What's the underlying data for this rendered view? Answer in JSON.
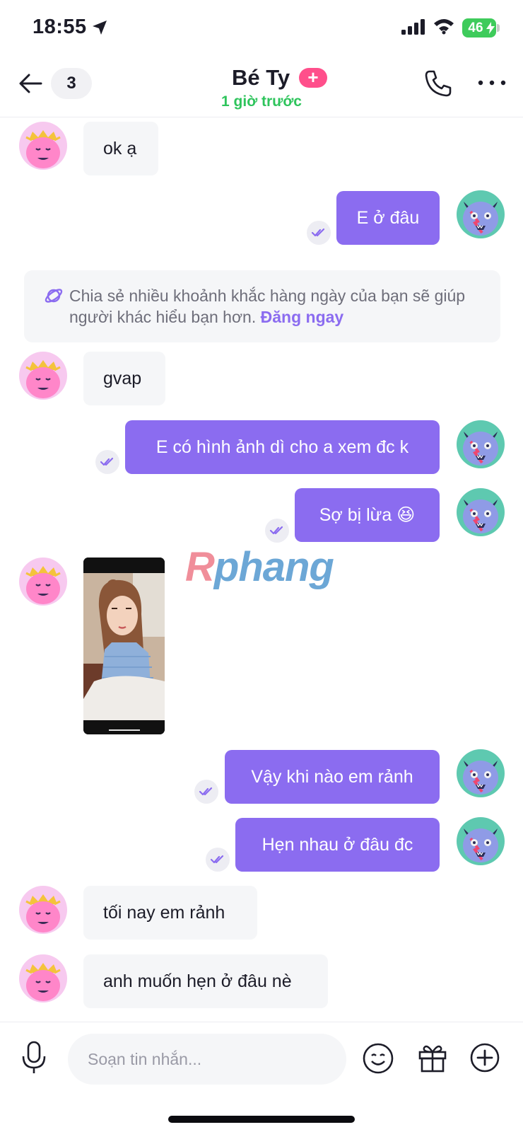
{
  "status_bar": {
    "time": "18:55",
    "battery": "46"
  },
  "header": {
    "back_icon": "arrow-left-icon",
    "unread_count": "3",
    "contact_name": "Bé Ty",
    "add_badge": "+",
    "presence": "1 giờ trước",
    "call_icon": "phone-icon",
    "more_icon": "more-horizontal-icon"
  },
  "colors": {
    "accent": "#8b6cf0",
    "incoming_bubble": "#f5f6f8",
    "online_green": "#2ec45c",
    "badge_pink": "#ff4f8b"
  },
  "messages": [
    {
      "from": "contact",
      "text": "ok ạ"
    },
    {
      "from": "me",
      "text": "E ở đâu"
    },
    {
      "from": "me",
      "text": "E có hình ảnh dì cho a xem đc k"
    },
    {
      "from": "me",
      "text": "Sợ bị lừa 😆"
    },
    {
      "from": "contact",
      "text": "gvap"
    },
    {
      "from": "me",
      "text": "Vậy khi nào em rảnh"
    },
    {
      "from": "me",
      "text": "Hẹn nhau ở đâu đc"
    },
    {
      "from": "contact",
      "text": "tối nay em rảnh"
    },
    {
      "from": "contact",
      "text": "anh muốn hẹn ở đâu nè"
    }
  ],
  "tip": {
    "icon": "planet-icon",
    "text": "Chia sẻ nhiều khoảnh khắc hàng ngày của bạn sẽ giúp người khác hiểu bạn hơn.",
    "link": "Đăng ngay"
  },
  "watermark": {
    "first": "R",
    "rest": "phang"
  },
  "composer": {
    "placeholder": "Soạn tin nhắn...",
    "mic_icon": "microphone-icon",
    "emoji_icon": "smiley-icon",
    "gift_icon": "gift-icon",
    "plus_icon": "plus-circle-icon"
  }
}
